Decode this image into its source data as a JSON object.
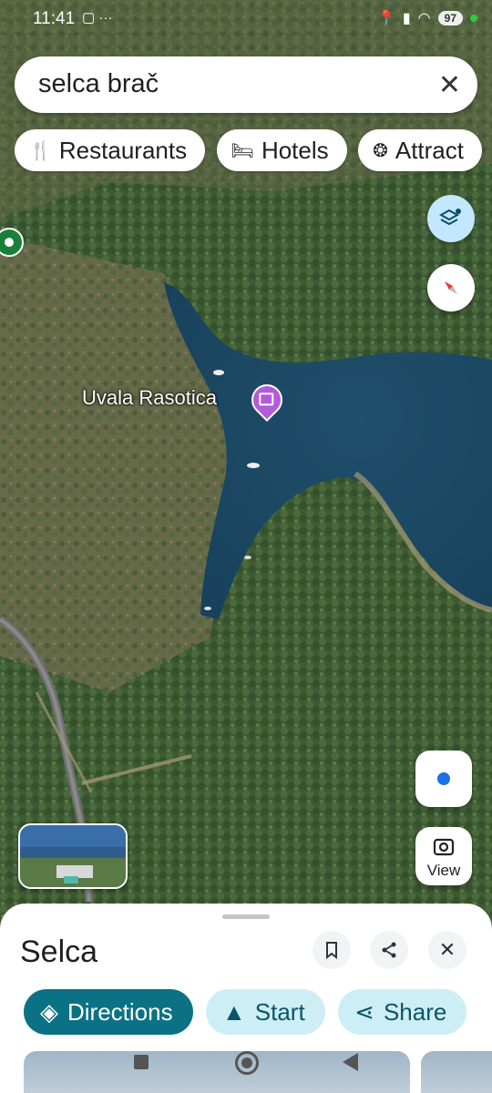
{
  "status": {
    "time": "11:41",
    "battery": "97"
  },
  "search": {
    "query": "selca brač"
  },
  "chips": [
    {
      "label": "Restaurants",
      "icon": "fork-knife-icon"
    },
    {
      "label": "Hotels",
      "icon": "bed-icon"
    },
    {
      "label": "Attract",
      "icon": "ferris-wheel-icon"
    }
  ],
  "map": {
    "poi": {
      "label": "Uvala Rasotica",
      "icon": "camera-icon"
    },
    "view_label": "View"
  },
  "sheet": {
    "title": "Selca",
    "actions": {
      "directions": "Directions",
      "start": "Start",
      "share": "Share"
    }
  },
  "colors": {
    "primary": "#0b7285",
    "secondary": "#cdeef5",
    "poi": "#b35bd9",
    "location": "#1a73e8"
  }
}
